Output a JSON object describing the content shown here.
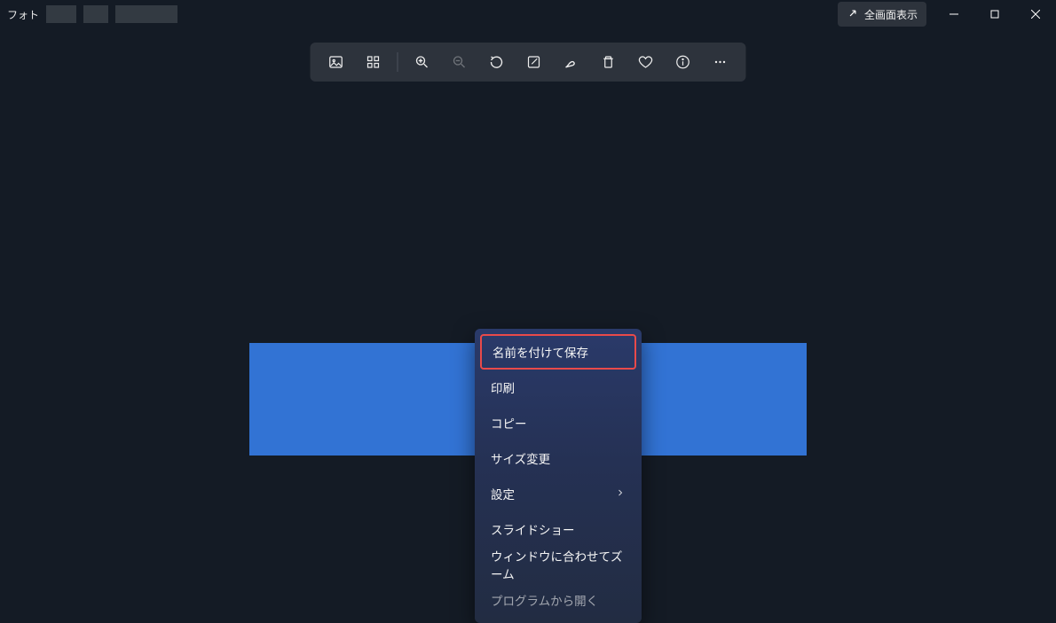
{
  "titlebar": {
    "app_name": "フォト",
    "fullscreen_label": "全画面表示"
  },
  "toolbar": {
    "icons": [
      "image",
      "filmstrip",
      "zoom-in",
      "zoom-out",
      "rotate",
      "edit",
      "markup",
      "delete",
      "favorite",
      "info",
      "more"
    ]
  },
  "context_menu": {
    "items": [
      {
        "label": "名前を付けて保存",
        "highlight": true
      },
      {
        "label": "印刷"
      },
      {
        "label": "コピー"
      },
      {
        "label": "サイズ変更"
      },
      {
        "label": "設定",
        "submenu": true
      },
      {
        "label": "スライドショー"
      },
      {
        "label": "ウィンドウに合わせてズーム"
      },
      {
        "label": "プログラムから開く"
      }
    ]
  }
}
